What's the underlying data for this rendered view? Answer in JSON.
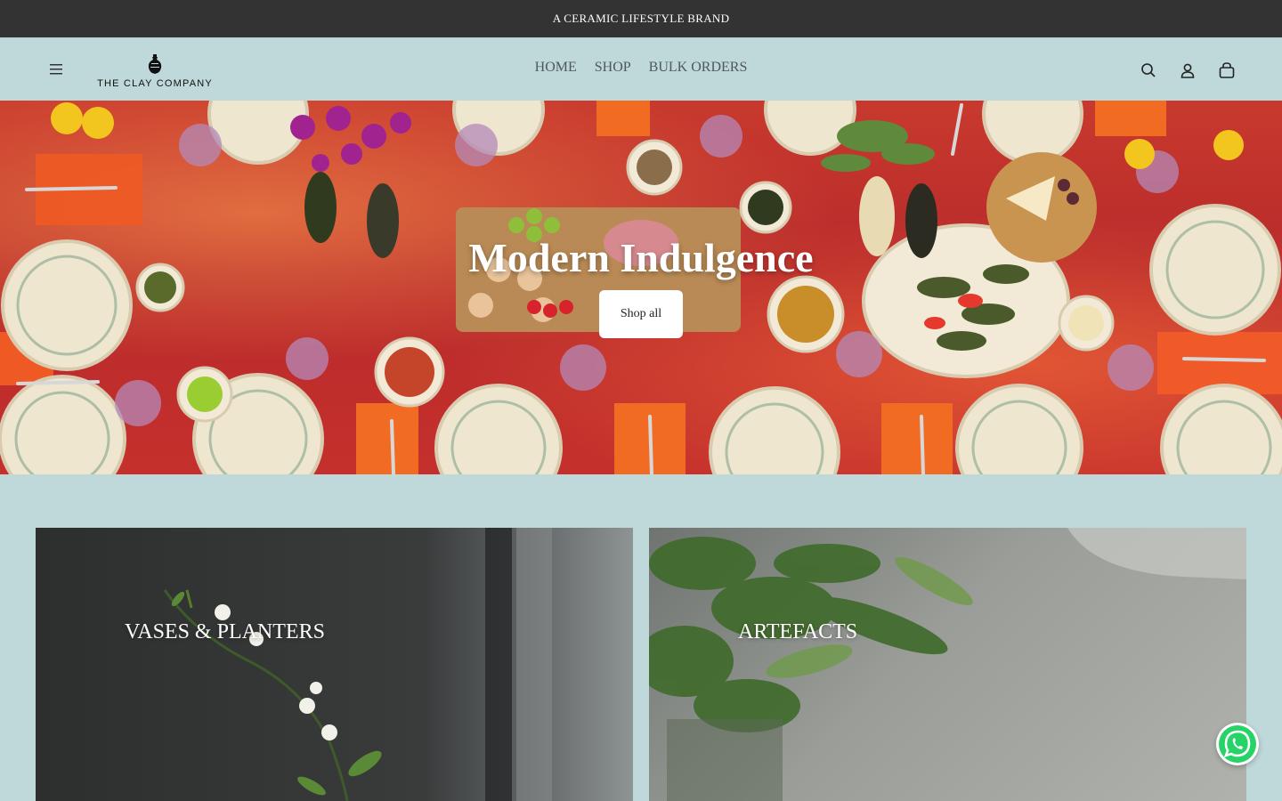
{
  "announcement": {
    "text": "A CERAMIC LIFESTYLE BRAND"
  },
  "header": {
    "brand": "THE CLAY COMPANY",
    "nav": [
      {
        "label": "HOME"
      },
      {
        "label": "SHOP"
      },
      {
        "label": "BULK ORDERS"
      }
    ],
    "icons": [
      "menu-icon",
      "search-icon",
      "account-icon",
      "cart-icon"
    ]
  },
  "hero": {
    "title": "Modern Indulgence",
    "button": "Shop all"
  },
  "collections": [
    {
      "title": "VASES & PLANTERS"
    },
    {
      "title": "ARTEFACTS"
    }
  ],
  "colors": {
    "announcement_bg": "#333333",
    "header_bg": "#bfd8d9",
    "hero_table": "#c5302c",
    "whatsapp": "#25d366"
  }
}
